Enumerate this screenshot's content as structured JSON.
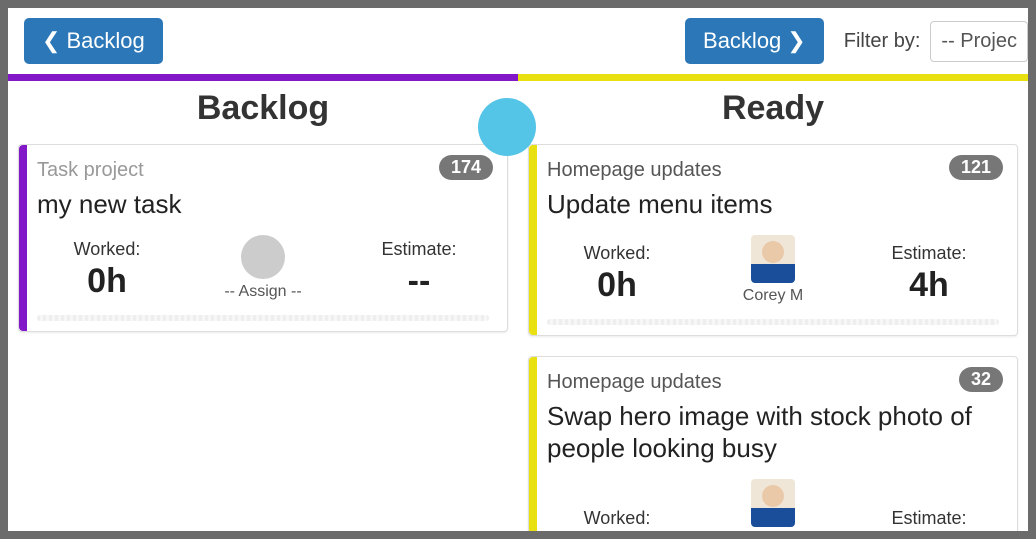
{
  "toolbar": {
    "prev_label": "Backlog",
    "next_label": "Backlog",
    "filter_label": "Filter by:",
    "filter_value": "-- Projec"
  },
  "lanes": [
    {
      "title": "Backlog",
      "color": "#8318c9",
      "cards": [
        {
          "project": "Task project",
          "badge": "174",
          "title": "my new task",
          "worked_label": "Worked:",
          "worked_value": "0h",
          "assignee_label": "-- Assign --",
          "assignee_avatar": false,
          "estimate_label": "Estimate:",
          "estimate_value": "--"
        }
      ]
    },
    {
      "title": "Ready",
      "color": "#e9e012",
      "cards": [
        {
          "project": "Homepage updates",
          "badge": "121",
          "title": "Update menu items",
          "worked_label": "Worked:",
          "worked_value": "0h",
          "assignee_label": "Corey M",
          "assignee_avatar": true,
          "estimate_label": "Estimate:",
          "estimate_value": "4h"
        },
        {
          "project": "Homepage updates",
          "badge": "32",
          "title": "Swap hero image with stock photo of people looking busy",
          "worked_label": "Worked:",
          "worked_value": "",
          "assignee_label": "",
          "assignee_avatar": true,
          "estimate_label": "Estimate:",
          "estimate_value": ""
        }
      ]
    }
  ]
}
